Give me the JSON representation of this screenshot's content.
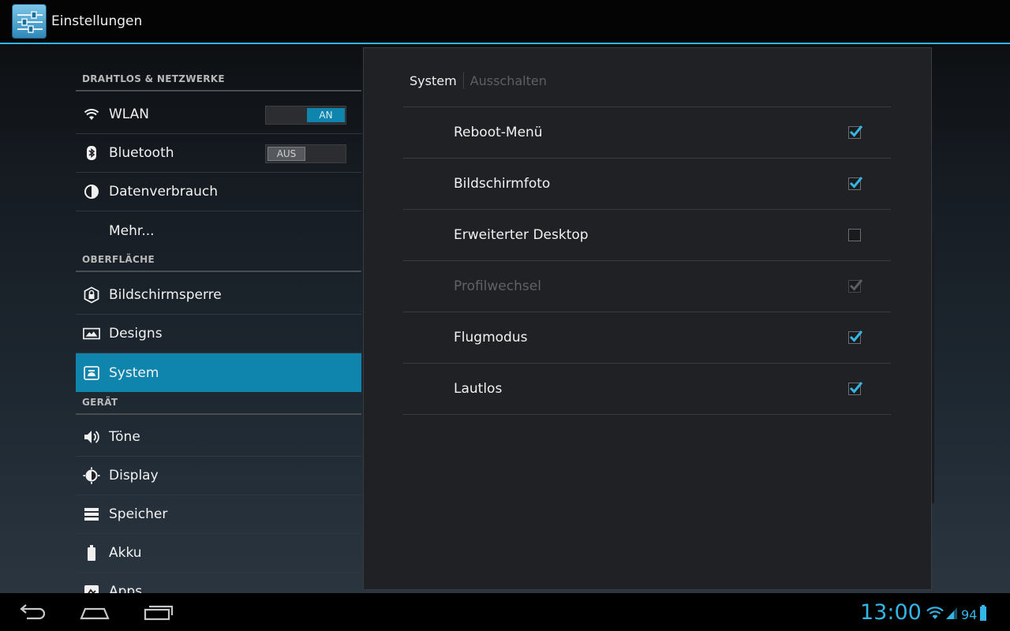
{
  "action_bar": {
    "title": "Einstellungen",
    "icon": "settings-sliders-icon"
  },
  "left_pane": {
    "sections": [
      {
        "header": "DRAHTLOS & NETZWERKE"
      },
      {
        "header": "OBERFLÄCHE"
      },
      {
        "header": "GERÄT"
      }
    ],
    "items": [
      {
        "label": "WLAN",
        "icon": "wifi-icon",
        "toggle": "AN"
      },
      {
        "label": "Bluetooth",
        "icon": "bluetooth-icon",
        "toggle": "AUS"
      },
      {
        "label": "Datenverbrauch",
        "icon": "data-usage-icon"
      },
      {
        "label": "Mehr..."
      },
      {
        "label": "Bildschirmsperre",
        "icon": "lock-icon"
      },
      {
        "label": "Designs",
        "icon": "themes-icon"
      },
      {
        "label": "System",
        "icon": "system-icon",
        "selected": true
      },
      {
        "label": "Töne",
        "icon": "sound-icon"
      },
      {
        "label": "Display",
        "icon": "display-icon"
      },
      {
        "label": "Speicher",
        "icon": "storage-icon"
      },
      {
        "label": "Akku",
        "icon": "battery-icon"
      },
      {
        "label": "Apps",
        "icon": "apps-icon"
      }
    ]
  },
  "right_pane": {
    "tabs": [
      {
        "label": "System",
        "active": true
      },
      {
        "label": "Ausschalten",
        "active": false
      }
    ],
    "prefs": [
      {
        "label": "Reboot-Menü",
        "checked": true,
        "enabled": true
      },
      {
        "label": "Bildschirmfoto",
        "checked": true,
        "enabled": true
      },
      {
        "label": "Erweiterter Desktop",
        "checked": false,
        "enabled": true
      },
      {
        "label": "Profilwechsel",
        "checked": true,
        "enabled": false
      },
      {
        "label": "Flugmodus",
        "checked": true,
        "enabled": true
      },
      {
        "label": "Lautlos",
        "checked": true,
        "enabled": true
      }
    ]
  },
  "nav_bar": {
    "buttons": [
      "back-icon",
      "home-icon",
      "recent-apps-icon"
    ],
    "clock": "13:00",
    "battery": "94"
  },
  "colors": {
    "accent": "#33b5e5",
    "selected": "#0f85ae"
  }
}
